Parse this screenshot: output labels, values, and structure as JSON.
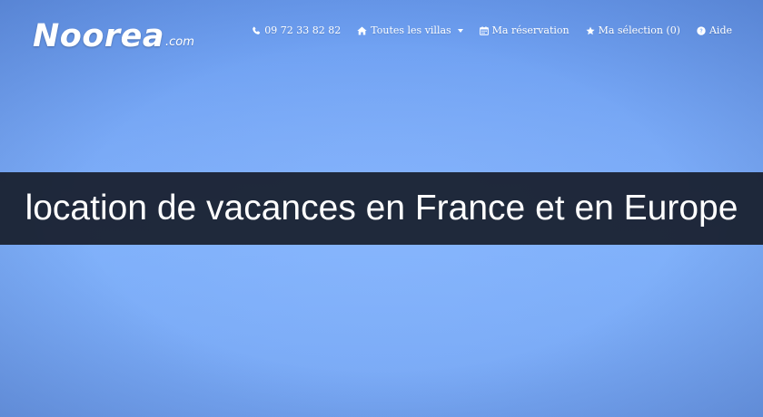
{
  "header": {
    "logo_main": "Noorea",
    "logo_suffix": ".com"
  },
  "nav": {
    "phone": {
      "label": "09 72 33 82 82",
      "icon": "phone-icon"
    },
    "villas": {
      "label": "Toutes les villas",
      "icon": "home-icon"
    },
    "reservation": {
      "label": "Ma réservation",
      "icon": "calendar-icon"
    },
    "selection": {
      "label": "Ma sélection (0)",
      "icon": "star-icon"
    },
    "help": {
      "label": "Aide",
      "icon": "question-circle-icon"
    }
  },
  "hero": {
    "title": "location de vacances en France et en Europe"
  },
  "colors": {
    "background": "#79a9f6",
    "banner": "#181e2c",
    "text": "#ffffff"
  }
}
